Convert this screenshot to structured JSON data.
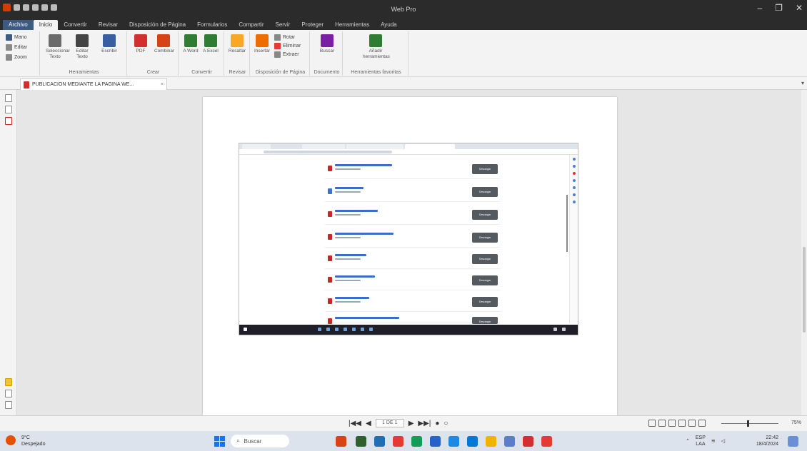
{
  "window": {
    "title": "Web Pro",
    "minimize": "–",
    "maximize": "❐",
    "close": "✕"
  },
  "menu": {
    "items": [
      "Archivo",
      "Inicio",
      "Convertir",
      "Revisar",
      "Disposición de Página",
      "Formularios",
      "Compartir",
      "Servir",
      "Proteger",
      "Herramientas",
      "Ayuda"
    ]
  },
  "ribbon": {
    "left_commands": [
      "Mano",
      "Editar",
      "Zoom"
    ],
    "buttons": [
      {
        "label": "Seleccionar Texto",
        "color": "#6b6b6b"
      },
      {
        "label": "Editar Texto",
        "color": "#444444"
      },
      {
        "label": "Escribir",
        "color": "#3a5fa0"
      },
      {
        "label": "PDF",
        "color": "#d32f2f"
      },
      {
        "label": "Combinar",
        "color": "#d84315"
      },
      {
        "label": "A Word",
        "color": "#2e7d32"
      },
      {
        "label": "A Excel",
        "color": "#2e7d32"
      },
      {
        "label": "Resaltar",
        "color": "#f9a825"
      },
      {
        "label": "Insertar",
        "color": "#ef6c00"
      },
      {
        "label": "Buscar",
        "color": "#7b1fa2"
      },
      {
        "label": "Añadir herramientas",
        "color": "#2e7d32"
      }
    ],
    "small_commands": [
      "Rotar",
      "Eliminar",
      "Extraer"
    ],
    "groups": [
      "Herramientas",
      "Crear",
      "Convertir",
      "Revisar",
      "Disposición de Página",
      "Documento",
      "Herramientas favoritas"
    ]
  },
  "document_tab": {
    "title": "PUBLICACION MEDIANTE LA PAGINA WE...",
    "close": "×"
  },
  "viewer": {
    "download_label": "Descargar",
    "item_count": 8
  },
  "bottom_bar": {
    "first": "|◀◀",
    "prev": "◀",
    "page": "1 DE 1",
    "next": "▶",
    "last": "▶▶|",
    "zoom": "75%"
  },
  "taskbar": {
    "weather_temp": "9°C",
    "weather_desc": "Despejado",
    "search_placeholder": "Buscar",
    "lang_top": "ESP",
    "lang_bottom": "LAA",
    "time": "22:42",
    "date": "18/4/2024",
    "app_colors": [
      "#d84315",
      "#2f5f2f",
      "#1f6fb2",
      "#e53935",
      "#0f9d58",
      "#2563c9",
      "#1e88e5",
      "#0078d4",
      "#f2b200",
      "#5c7ec9",
      "#d32f2f",
      "#e53935"
    ]
  }
}
